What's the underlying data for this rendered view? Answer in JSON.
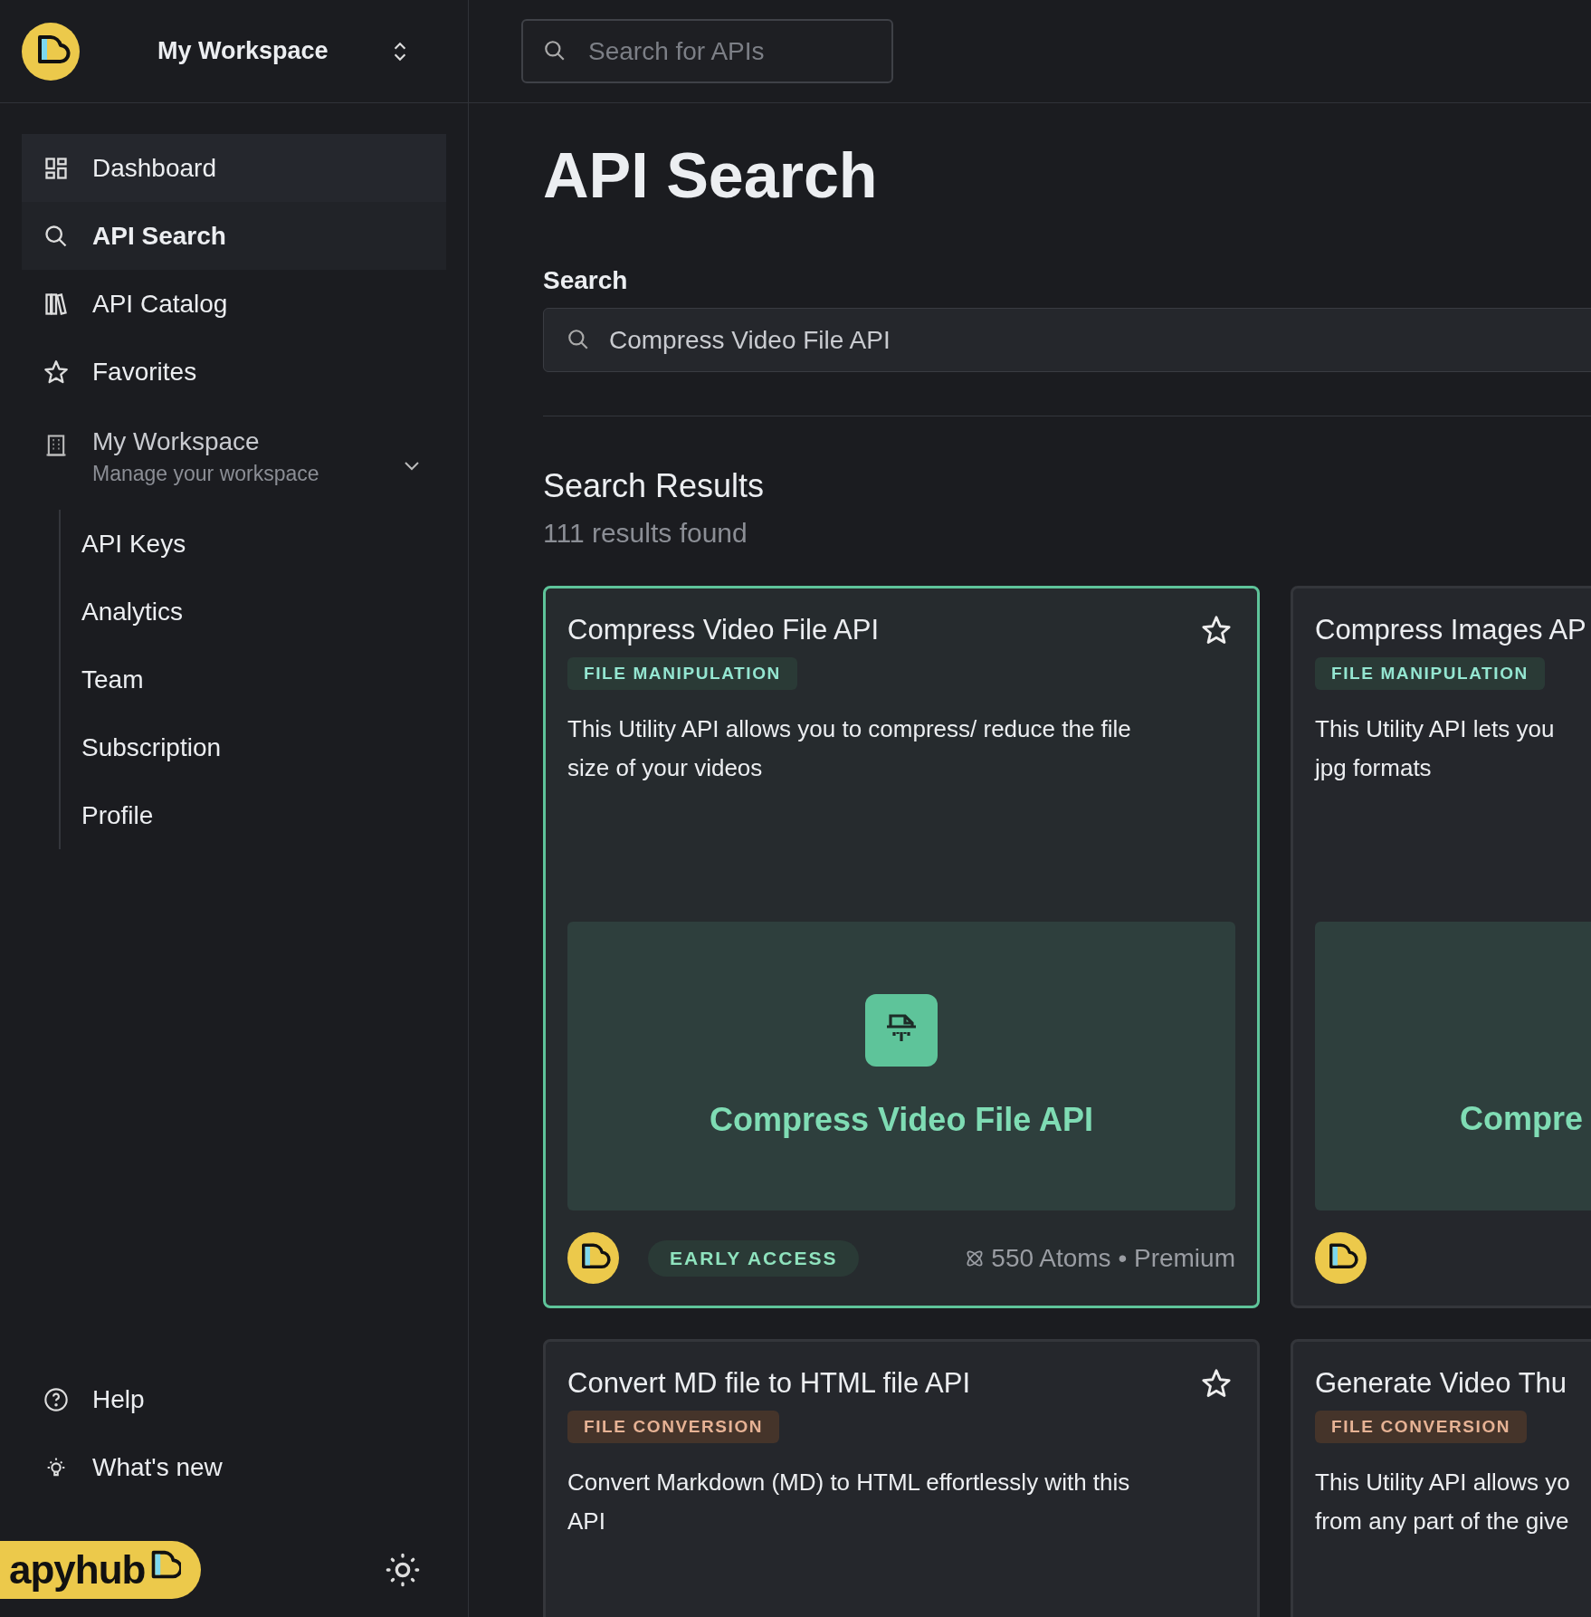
{
  "sidebar": {
    "workspace_name": "My Workspace",
    "nav": [
      {
        "label": "Dashboard",
        "selected": false,
        "hovered": true
      },
      {
        "label": "API Search",
        "selected": true,
        "hovered": false
      },
      {
        "label": "API Catalog",
        "selected": false,
        "hovered": false
      },
      {
        "label": "Favorites",
        "selected": false,
        "hovered": false
      }
    ],
    "workspace": {
      "title": "My Workspace",
      "subtitle": "Manage your workspace",
      "expanded": true,
      "children": [
        {
          "label": "API Keys"
        },
        {
          "label": "Analytics"
        },
        {
          "label": "Team"
        },
        {
          "label": "Subscription"
        },
        {
          "label": "Profile"
        }
      ]
    },
    "footer_links": [
      {
        "label": "Help"
      },
      {
        "label": "What's new"
      }
    ],
    "brand": "apyhub"
  },
  "topbar": {
    "search_placeholder": "Search for APIs"
  },
  "page": {
    "title": "API Search",
    "search_label": "Search",
    "search_value": "Compress Video File API",
    "results_title": "Search Results",
    "results_count": "111 results found"
  },
  "results": [
    {
      "title": "Compress Video File API",
      "selected": true,
      "favorite": false,
      "tag": {
        "label": "FILE MANIPULATION",
        "color": "#2a3a36"
      },
      "description": "This Utility API allows you to compress/ reduce the file\nsize of your videos",
      "preview": {
        "title": "Compress Video File API"
      },
      "footer": {
        "badge": "EARLY ACCESS",
        "meta": "550 Atoms • Premium"
      }
    },
    {
      "title": "Compress Images AP",
      "selected": false,
      "tag": {
        "label": "FILE MANIPULATION",
        "color": "#2a3a36"
      },
      "description": "This Utility API lets you\njpg formats",
      "preview": {
        "title": "Compre"
      }
    },
    {
      "title": "Convert MD file to HTML file API",
      "selected": false,
      "favorite": false,
      "tag": {
        "label": "FILE CONVERSION",
        "color": "#45342a"
      },
      "description": "Convert Markdown (MD) to HTML effortlessly with this\nAPI"
    },
    {
      "title": "Generate Video Thu",
      "selected": false,
      "tag": {
        "label": "FILE CONVERSION",
        "color": "#45342a"
      },
      "description": "This Utility API allows yo\nfrom any part of the give"
    }
  ]
}
